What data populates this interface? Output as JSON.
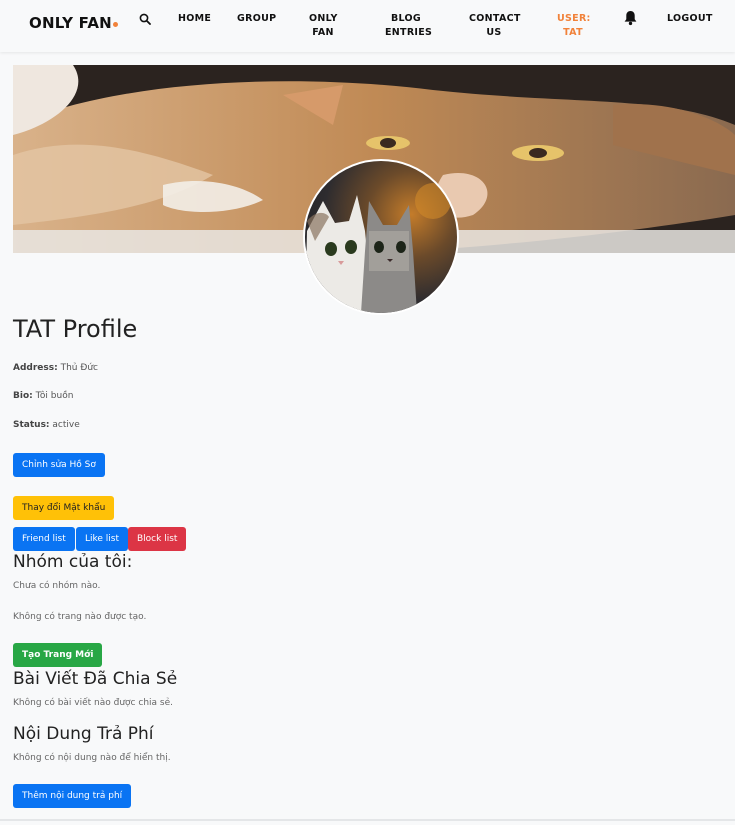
{
  "navbar": {
    "brand": "ONLY FAN",
    "brand_accent_color": "#f1823a",
    "search_icon": "search-icon",
    "links": {
      "home": "HOME",
      "group": "GROUP",
      "only_fan_line1": "ONLY",
      "only_fan_line2": "FAN",
      "blog_line1": "BLOG",
      "blog_line2": "ENTRIES",
      "contact_line1": "CONTACT",
      "contact_line2": "US",
      "user_line1": "USER:",
      "user_line2": "TAT",
      "logout": "LOGOUT"
    },
    "bell_icon": "bell-icon"
  },
  "profile": {
    "title": "TAT Profile",
    "address_label": "Address:",
    "address_value": " Thủ Đức",
    "bio_label": "Bio:",
    "bio_value": " Tôi buồn",
    "status_label": "Status:",
    "status_value": " active"
  },
  "buttons": {
    "edit_profile": "Chỉnh sửa Hồ Sơ",
    "change_password": "Thay đổi Mật khẩu",
    "friend_list": "Friend list",
    "like_list": "Like list",
    "block_list": "Block list",
    "create_page": "Tạo Trang Mới",
    "add_paid_content": "Thêm nội dung trả phí"
  },
  "groups": {
    "title": "Nhóm của tôi:",
    "empty": "Chưa có nhóm nào.",
    "pages_empty": "Không có trang nào được tạo."
  },
  "shared_posts": {
    "title": "Bài Viết Đã Chia Sẻ",
    "empty": "Không có bài viết nào được chia sẻ."
  },
  "paid_content": {
    "title": "Nội Dung Trả Phí",
    "empty": "Không có nội dung nào để hiển thị."
  },
  "colors": {
    "primary": "#0a74f3",
    "warning": "#ffc107",
    "danger": "#dc3545",
    "success": "#28a745",
    "accent": "#f1823a"
  }
}
